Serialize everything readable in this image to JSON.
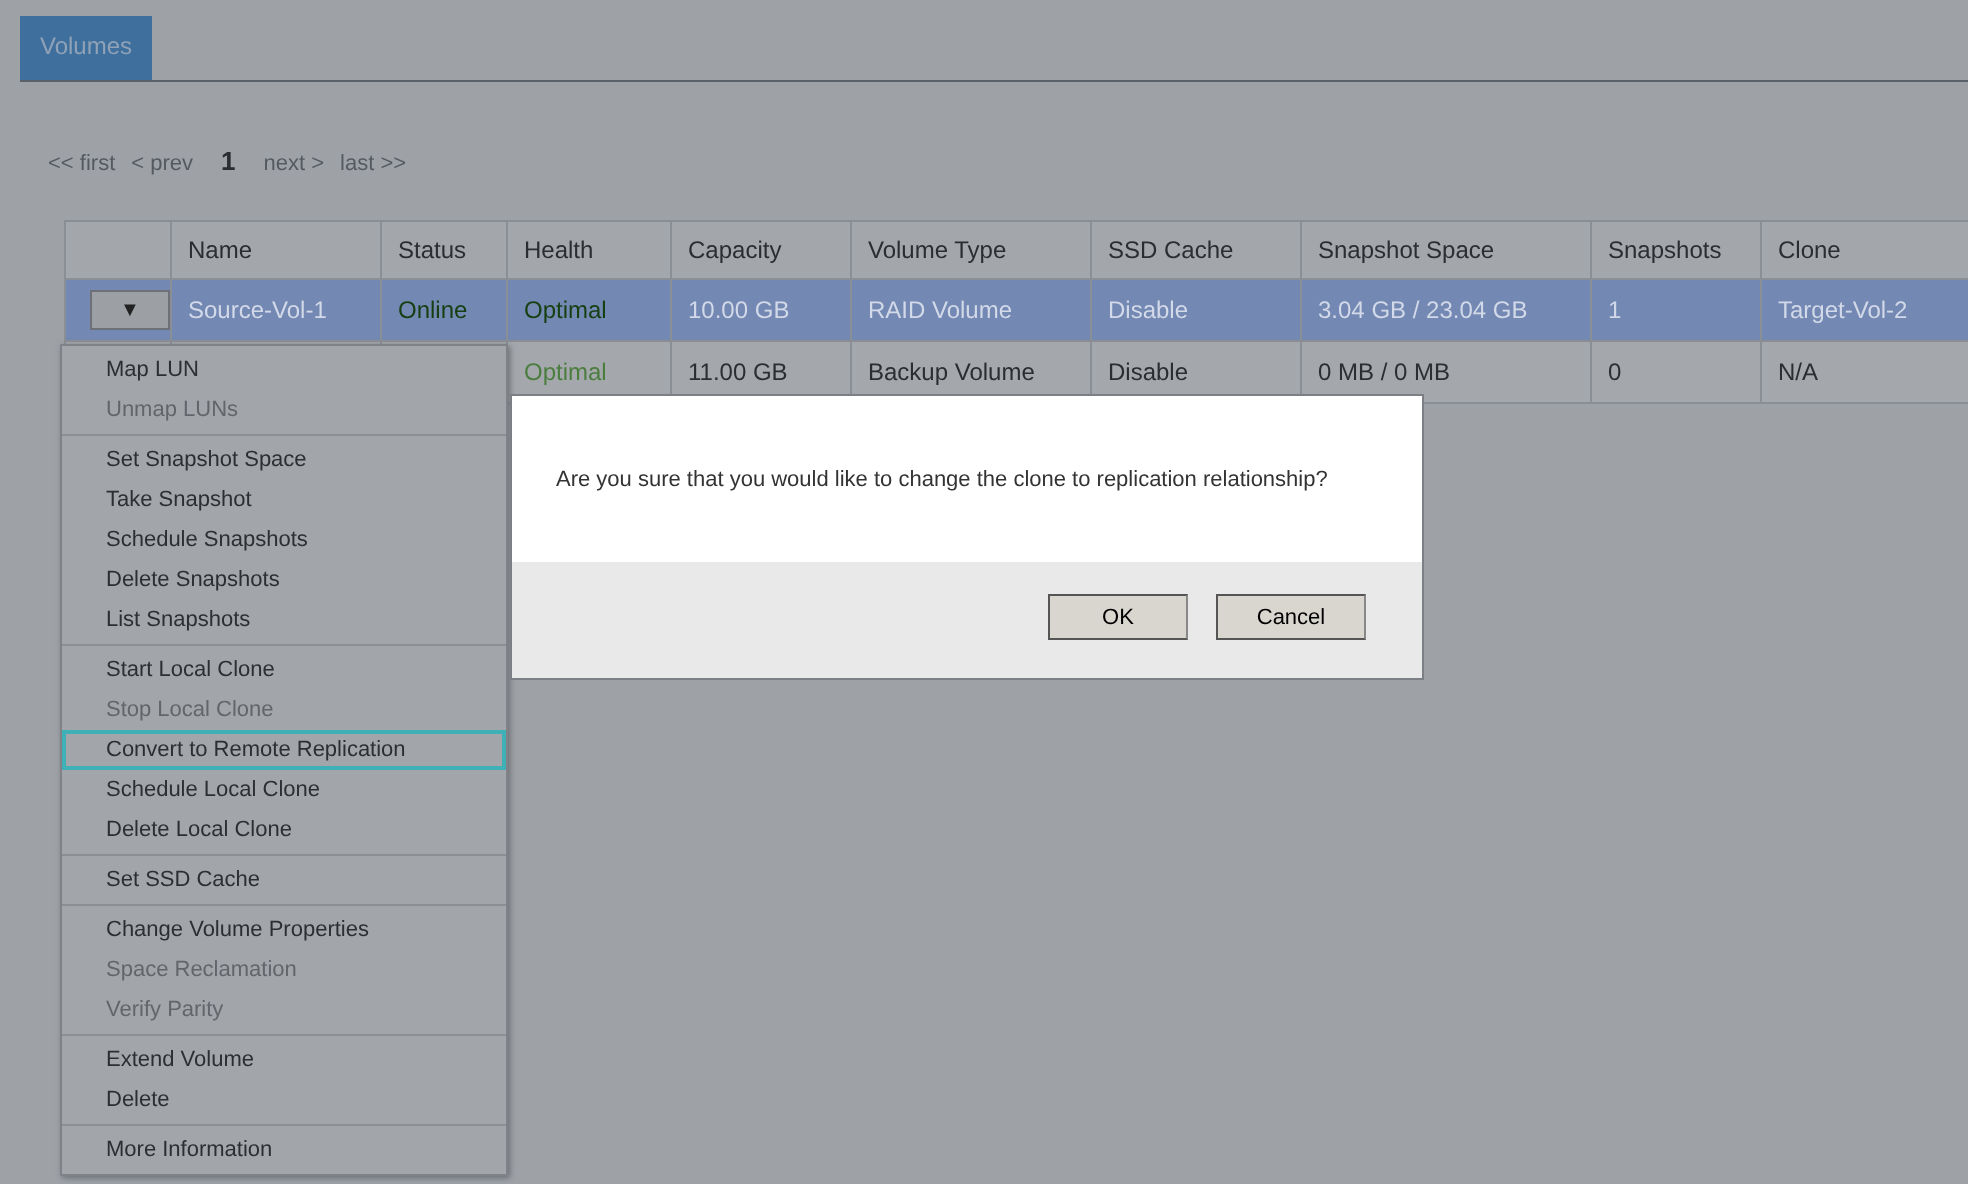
{
  "tabs": [
    {
      "label": "Volumes",
      "selected": true
    }
  ],
  "pager": [
    {
      "label": "<< first",
      "current": false
    },
    {
      "label": "< prev",
      "current": false
    },
    {
      "label": "1",
      "current": true
    },
    {
      "label": "next >",
      "current": false
    },
    {
      "label": "last >>",
      "current": false
    }
  ],
  "table": {
    "columns": [
      "Name",
      "Status",
      "Health",
      "Capacity",
      "Volume Type",
      "SSD Cache",
      "Snapshot Space",
      "Snapshots",
      "Clone"
    ],
    "rows": [
      {
        "selected": true,
        "action": "▼",
        "cells": [
          "Source-Vol-1",
          "Online",
          "Optimal",
          "10.00 GB",
          "RAID Volume",
          "Disable",
          "3.04 GB / 23.04 GB",
          "1",
          "Target-Vol-2"
        ]
      },
      {
        "selected": false,
        "cells": [
          "",
          "",
          "Optimal",
          "11.00 GB",
          "Backup Volume",
          "Disable",
          "0 MB / 0 MB",
          "0",
          "N/A"
        ]
      }
    ]
  },
  "menu": {
    "groups": [
      [
        {
          "label": "Map LUN",
          "disabled": false,
          "selected": false
        },
        {
          "label": "Unmap LUNs",
          "disabled": true,
          "selected": false
        }
      ],
      [
        {
          "label": "Set Snapshot Space",
          "disabled": false,
          "selected": false
        },
        {
          "label": "Take Snapshot",
          "disabled": false,
          "selected": false
        },
        {
          "label": "Schedule Snapshots",
          "disabled": false,
          "selected": false
        },
        {
          "label": "Delete Snapshots",
          "disabled": false,
          "selected": false
        },
        {
          "label": "List Snapshots",
          "disabled": false,
          "selected": false
        }
      ],
      [
        {
          "label": "Start Local Clone",
          "disabled": false,
          "selected": false
        },
        {
          "label": "Stop Local Clone",
          "disabled": true,
          "selected": false
        },
        {
          "label": "Convert to Remote Replication",
          "disabled": false,
          "selected": true
        },
        {
          "label": "Schedule Local Clone",
          "disabled": false,
          "selected": false
        },
        {
          "label": "Delete Local Clone",
          "disabled": false,
          "selected": false
        }
      ],
      [
        {
          "label": "Set SSD Cache",
          "disabled": false,
          "selected": false
        }
      ],
      [
        {
          "label": "Change Volume Properties",
          "disabled": false,
          "selected": false
        },
        {
          "label": "Space Reclamation",
          "disabled": true,
          "selected": false
        },
        {
          "label": "Verify Parity",
          "disabled": true,
          "selected": false
        }
      ],
      [
        {
          "label": "Extend Volume",
          "disabled": false,
          "selected": false
        },
        {
          "label": "Delete",
          "disabled": false,
          "selected": false
        }
      ],
      [
        {
          "label": "More Information",
          "disabled": false,
          "selected": false
        }
      ]
    ]
  },
  "dialog": {
    "message": "Are you sure that you would like to change the clone to replication relationship?",
    "buttons": [
      "OK",
      "Cancel"
    ]
  }
}
